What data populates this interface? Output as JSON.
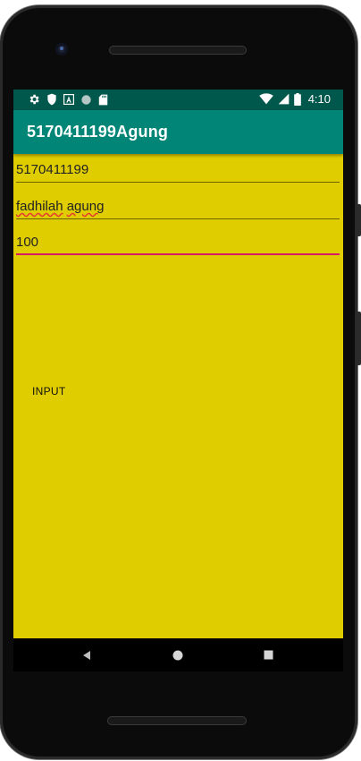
{
  "status_bar": {
    "time": "4:10",
    "left_icons": [
      "gear-icon",
      "shield-icon",
      "a-letter-icon",
      "circle-icon",
      "sd-card-icon"
    ],
    "right_icons": [
      "wifi-icon",
      "signal-icon",
      "battery-icon"
    ]
  },
  "app_bar": {
    "title": "5170411199Agung",
    "color": "#008577",
    "status_color": "#00574b"
  },
  "form": {
    "background": "#dfcd00",
    "fields": [
      {
        "value": "5170411199"
      },
      {
        "value_word1": "fadhilah",
        "value_space": " ",
        "value_word2": "agung"
      },
      {
        "value": "100"
      }
    ],
    "button_label": "INPUT"
  },
  "nav_bar": {
    "buttons": [
      "back-icon",
      "home-icon",
      "recents-icon"
    ]
  }
}
